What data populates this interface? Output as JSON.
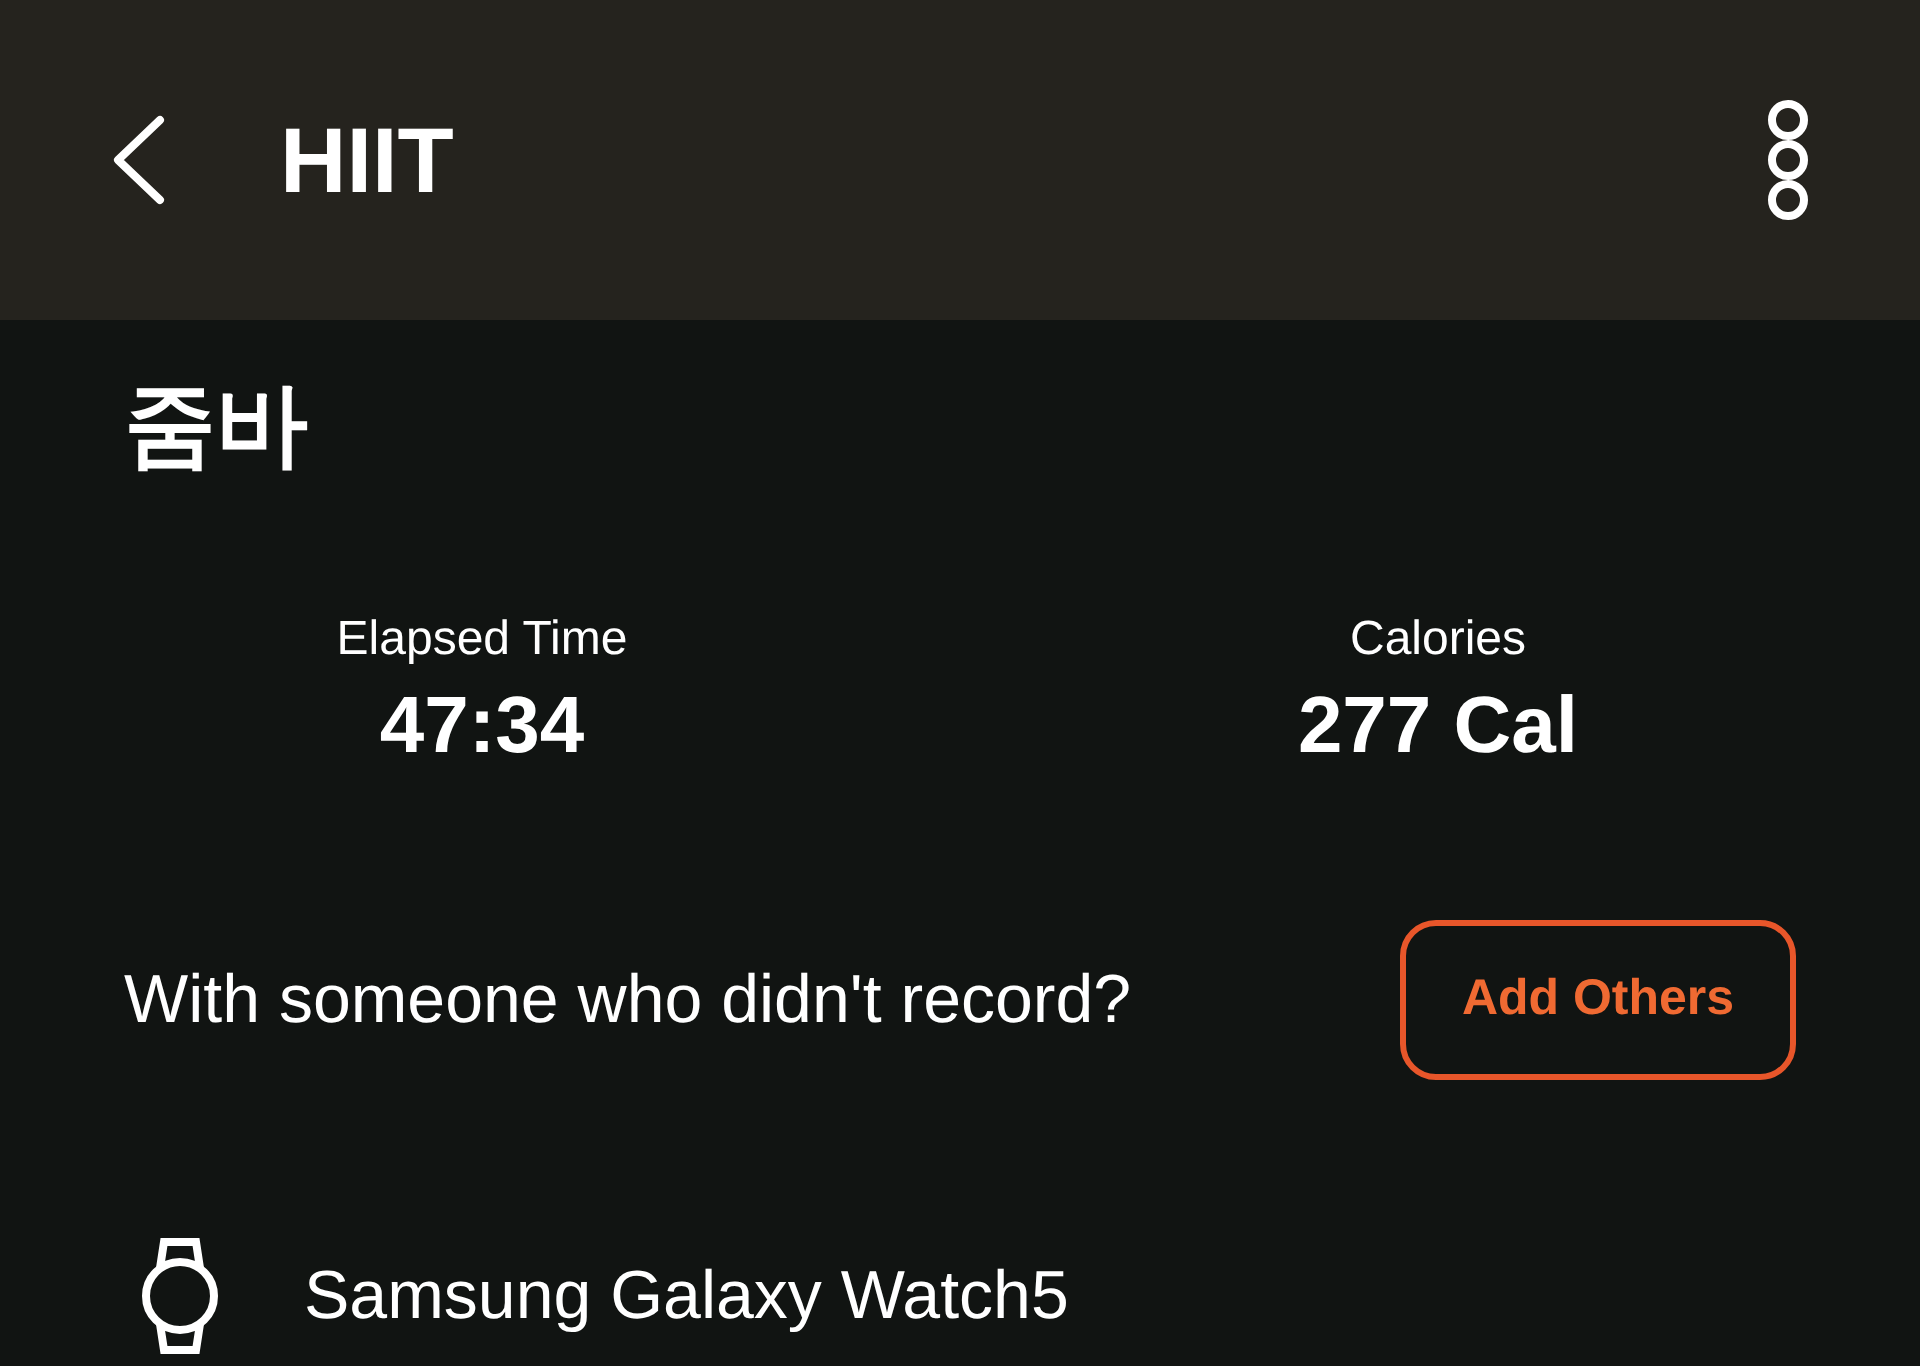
{
  "header": {
    "title": "HIIT"
  },
  "activity": {
    "name": "줌바"
  },
  "stats": [
    {
      "label": "Elapsed Time",
      "value": "47:34"
    },
    {
      "label": "Calories",
      "value": "277 Cal"
    }
  ],
  "companions": {
    "question": "With someone who didn't record?",
    "button": "Add Others"
  },
  "device": {
    "name": "Samsung Galaxy Watch5"
  }
}
